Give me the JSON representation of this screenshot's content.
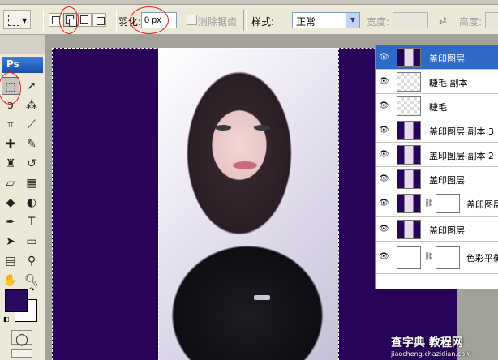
{
  "options_bar": {
    "feather_label": "羽化:",
    "feather_value": "0 px",
    "antialias_label": "消除锯齿",
    "style_label": "样式:",
    "style_value": "正常",
    "width_label": "宽度:",
    "height_label": "高度:"
  },
  "toolbox": {
    "logo": "Ps",
    "fg_color": "#2a0a5e",
    "bg_color": "#ffffff"
  },
  "canvas": {
    "background_color": "#28035a"
  },
  "layers": [
    {
      "name": "盖印图层",
      "thumb": "photo",
      "active": true
    },
    {
      "name": "睫毛 副本",
      "thumb": "transparent"
    },
    {
      "name": "睫毛",
      "thumb": "transparent"
    },
    {
      "name": "盖印图层 副本 3",
      "thumb": "photo"
    },
    {
      "name": "盖印图层 副本 2",
      "thumb": "photo"
    },
    {
      "name": "盖印图层",
      "thumb": "photo"
    },
    {
      "name": "盖印图层",
      "thumb": "photo",
      "mask": true
    },
    {
      "name": "盖印图层",
      "thumb": "photo"
    },
    {
      "name": "色彩平衡",
      "thumb": "adjustment",
      "mask": true
    }
  ],
  "watermark": {
    "line1": "查字典 教程网",
    "line2": "jiaocheng.chazidian.com"
  },
  "annotation_color": "#e02020"
}
